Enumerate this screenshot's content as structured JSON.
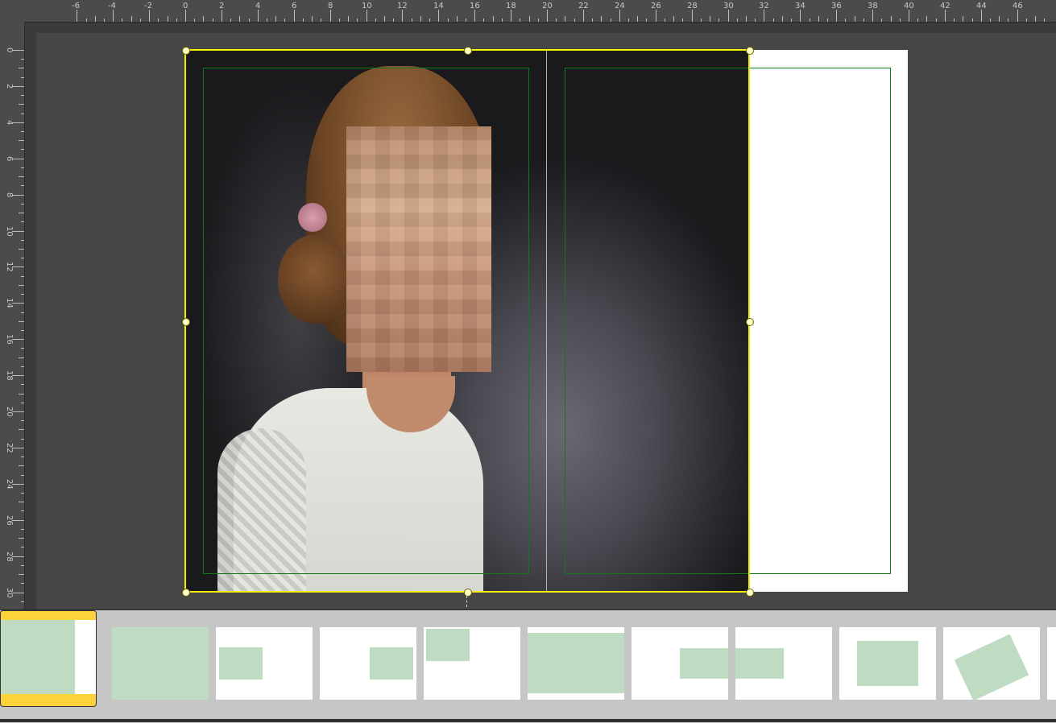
{
  "rulers": {
    "top_labels": [
      "-6",
      "-4",
      "-2",
      "0",
      "2",
      "4",
      "6",
      "8",
      "10",
      "12",
      "14",
      "16",
      "18",
      "20",
      "22",
      "24",
      "26",
      "28",
      "30",
      "32",
      "34",
      "36",
      "38",
      "40",
      "42",
      "44",
      "46"
    ],
    "left_labels": [
      "0",
      "2",
      "4",
      "6",
      "8",
      "10",
      "12",
      "14",
      "16",
      "18",
      "20",
      "22",
      "24",
      "26",
      "28",
      "30"
    ],
    "unit": "cm"
  },
  "canvas": {
    "image_label": "portrait-photo",
    "selection_color": "#f4f000",
    "guide_color": "#0e7a18"
  },
  "thumbnails": [
    {
      "name": "layout-1",
      "selected": true
    },
    {
      "name": "layout-2"
    },
    {
      "name": "layout-3"
    },
    {
      "name": "layout-4"
    },
    {
      "name": "layout-5"
    },
    {
      "name": "layout-6"
    },
    {
      "name": "layout-7"
    },
    {
      "name": "layout-8"
    },
    {
      "name": "layout-9"
    },
    {
      "name": "layout-10"
    }
  ],
  "colors": {
    "thumb_fill": "#bfdcc2",
    "selected_thumb": "#fcd33a",
    "workspace": "#464646"
  }
}
